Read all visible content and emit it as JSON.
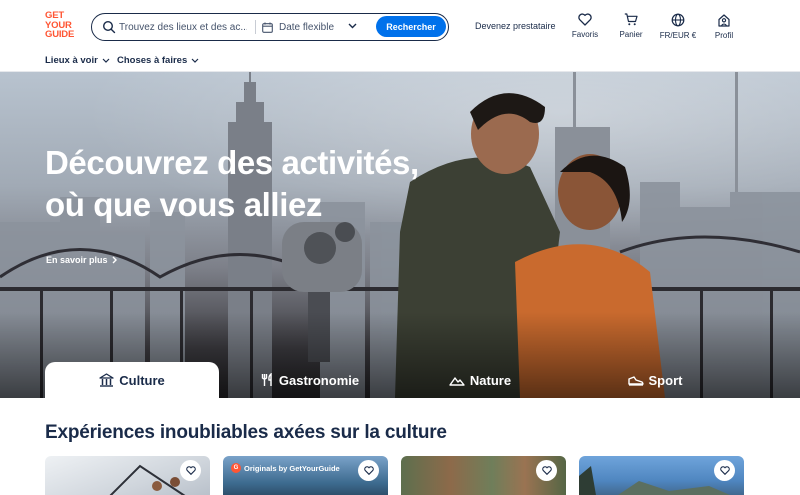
{
  "header": {
    "logo_lines": [
      "GET",
      "YOUR",
      "GUIDE"
    ],
    "search_placeholder": "Trouvez des lieux et des ac...",
    "date_label": "Date flexible",
    "search_button": "Rechercher",
    "supplier_link": "Devenez prestataire",
    "nav": [
      {
        "label": "Favoris",
        "icon": "heart-icon"
      },
      {
        "label": "Panier",
        "icon": "cart-icon"
      },
      {
        "label": "FR/EUR €",
        "icon": "globe-icon"
      },
      {
        "label": "Profil",
        "icon": "profile-icon"
      }
    ]
  },
  "subnav": [
    {
      "label": "Lieux à voir"
    },
    {
      "label": "Choses à faires"
    }
  ],
  "hero": {
    "title": "Découvrez des activités, où que vous alliez",
    "more_link": "En savoir plus"
  },
  "tabs": [
    {
      "label": "Culture",
      "icon": "museum-icon",
      "active": true
    },
    {
      "label": "Gastronomie",
      "icon": "fork-knife-icon",
      "active": false
    },
    {
      "label": "Nature",
      "icon": "mountain-icon",
      "active": false
    },
    {
      "label": "Sport",
      "icon": "sneaker-icon",
      "active": false
    }
  ],
  "section": {
    "title": "Expériences inoubliables axées sur la culture"
  },
  "cards": [
    {
      "badge": ""
    },
    {
      "badge": "Originals by GetYourGuide"
    },
    {
      "badge": ""
    },
    {
      "badge": ""
    }
  ],
  "colors": {
    "brand": "#ff5533",
    "primary_button": "#0071eb",
    "text": "#1a2b49"
  }
}
